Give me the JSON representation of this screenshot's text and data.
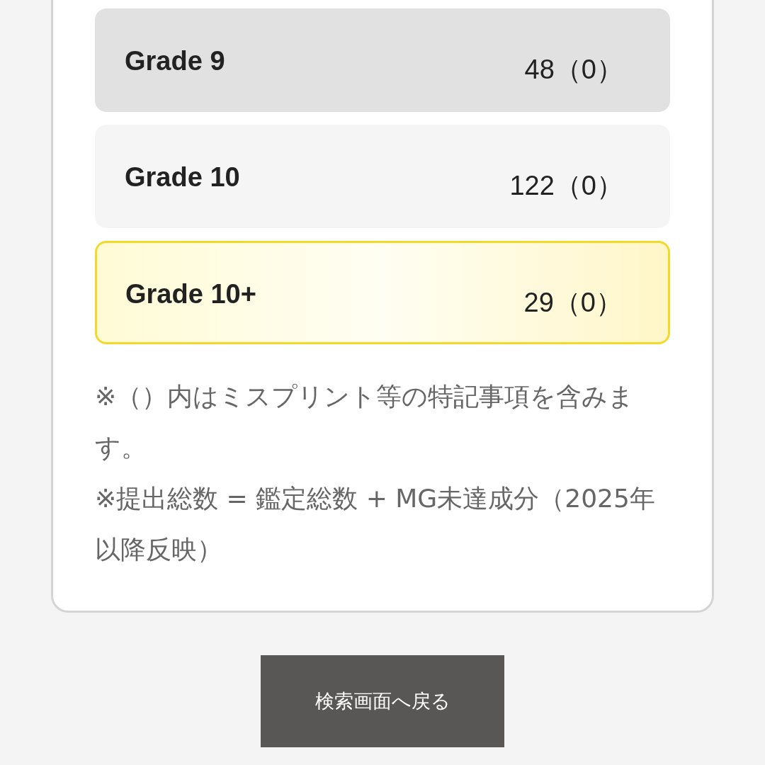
{
  "grades": [
    {
      "label": "Grade 9",
      "count": "48（0）",
      "kind": "shaded"
    },
    {
      "label": "Grade 10",
      "count": "122（0）",
      "kind": "plain"
    },
    {
      "label": "Grade 10+",
      "count": "29（0）",
      "kind": "highlight"
    }
  ],
  "notes": [
    "※（）内はミスプリント等の特記事項を含みます。",
    "※提出総数 = 鑑定総数 + MG未達成分（2025年以降反映）"
  ],
  "back_button": "検索画面へ戻る"
}
